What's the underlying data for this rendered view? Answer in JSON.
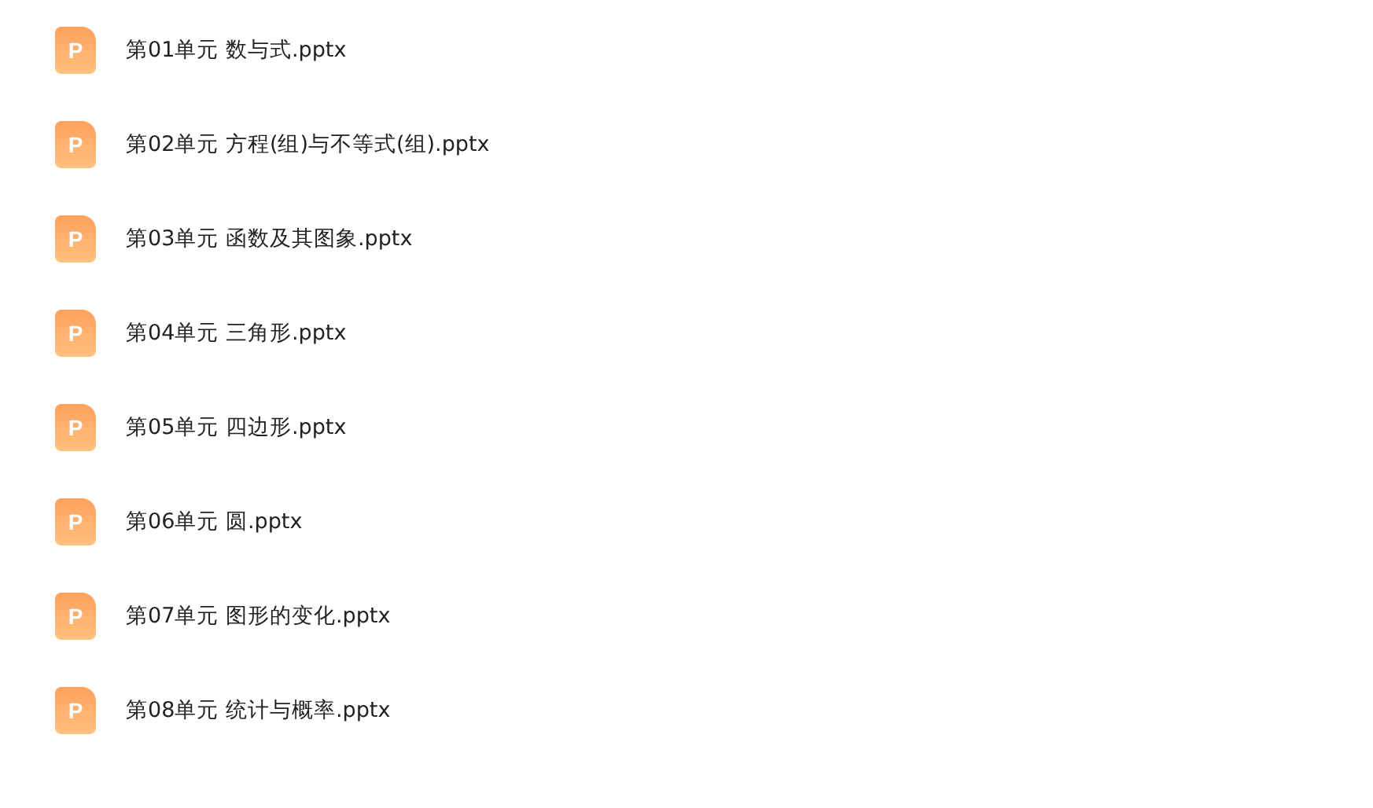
{
  "files": [
    {
      "name": "第01单元 数与式.pptx",
      "icon_letter": "P"
    },
    {
      "name": "第02单元 方程(组)与不等式(组).pptx",
      "icon_letter": "P"
    },
    {
      "name": "第03单元 函数及其图象.pptx",
      "icon_letter": "P"
    },
    {
      "name": "第04单元 三角形.pptx",
      "icon_letter": "P"
    },
    {
      "name": "第05单元 四边形.pptx",
      "icon_letter": "P"
    },
    {
      "name": "第06单元 圆.pptx",
      "icon_letter": "P"
    },
    {
      "name": "第07单元 图形的变化.pptx",
      "icon_letter": "P"
    },
    {
      "name": "第08单元 统计与概率.pptx",
      "icon_letter": "P"
    }
  ]
}
